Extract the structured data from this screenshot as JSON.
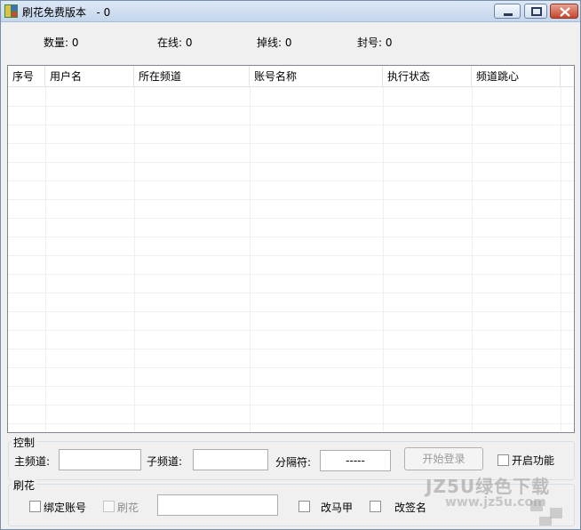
{
  "window": {
    "title": "刷花免费版本   - 0",
    "minimize_icon": "minimize-icon",
    "maximize_icon": "maximize-icon",
    "close_icon": "close-icon",
    "app_icon": "app-icon"
  },
  "stats": {
    "count": "数量: 0",
    "online": "在线: 0",
    "offline": "掉线: 0",
    "banned": "封号: 0"
  },
  "table": {
    "columns": [
      "序号",
      "用户名",
      "所在频道",
      "账号名称",
      "执行状态",
      "频道跳心"
    ],
    "rows": []
  },
  "control": {
    "group_title": "控制",
    "main_channel_label": "主频道:",
    "main_channel_value": "",
    "sub_channel_label": "子频道:",
    "sub_channel_value": "",
    "separator_label": "分隔符:",
    "separator_value": "-----",
    "start_login_button": "开始登录",
    "enable_function_label": "开启功能"
  },
  "flower": {
    "group_title": "刷花",
    "bind_account_label": "绑定账号",
    "flower_label": "刷花",
    "flower_value": "",
    "change_vest_label": "改马甲",
    "change_signature_label": "改签名"
  },
  "watermark": {
    "text": "JZ5U绿色下载",
    "sub": "www.jz5u.com"
  }
}
